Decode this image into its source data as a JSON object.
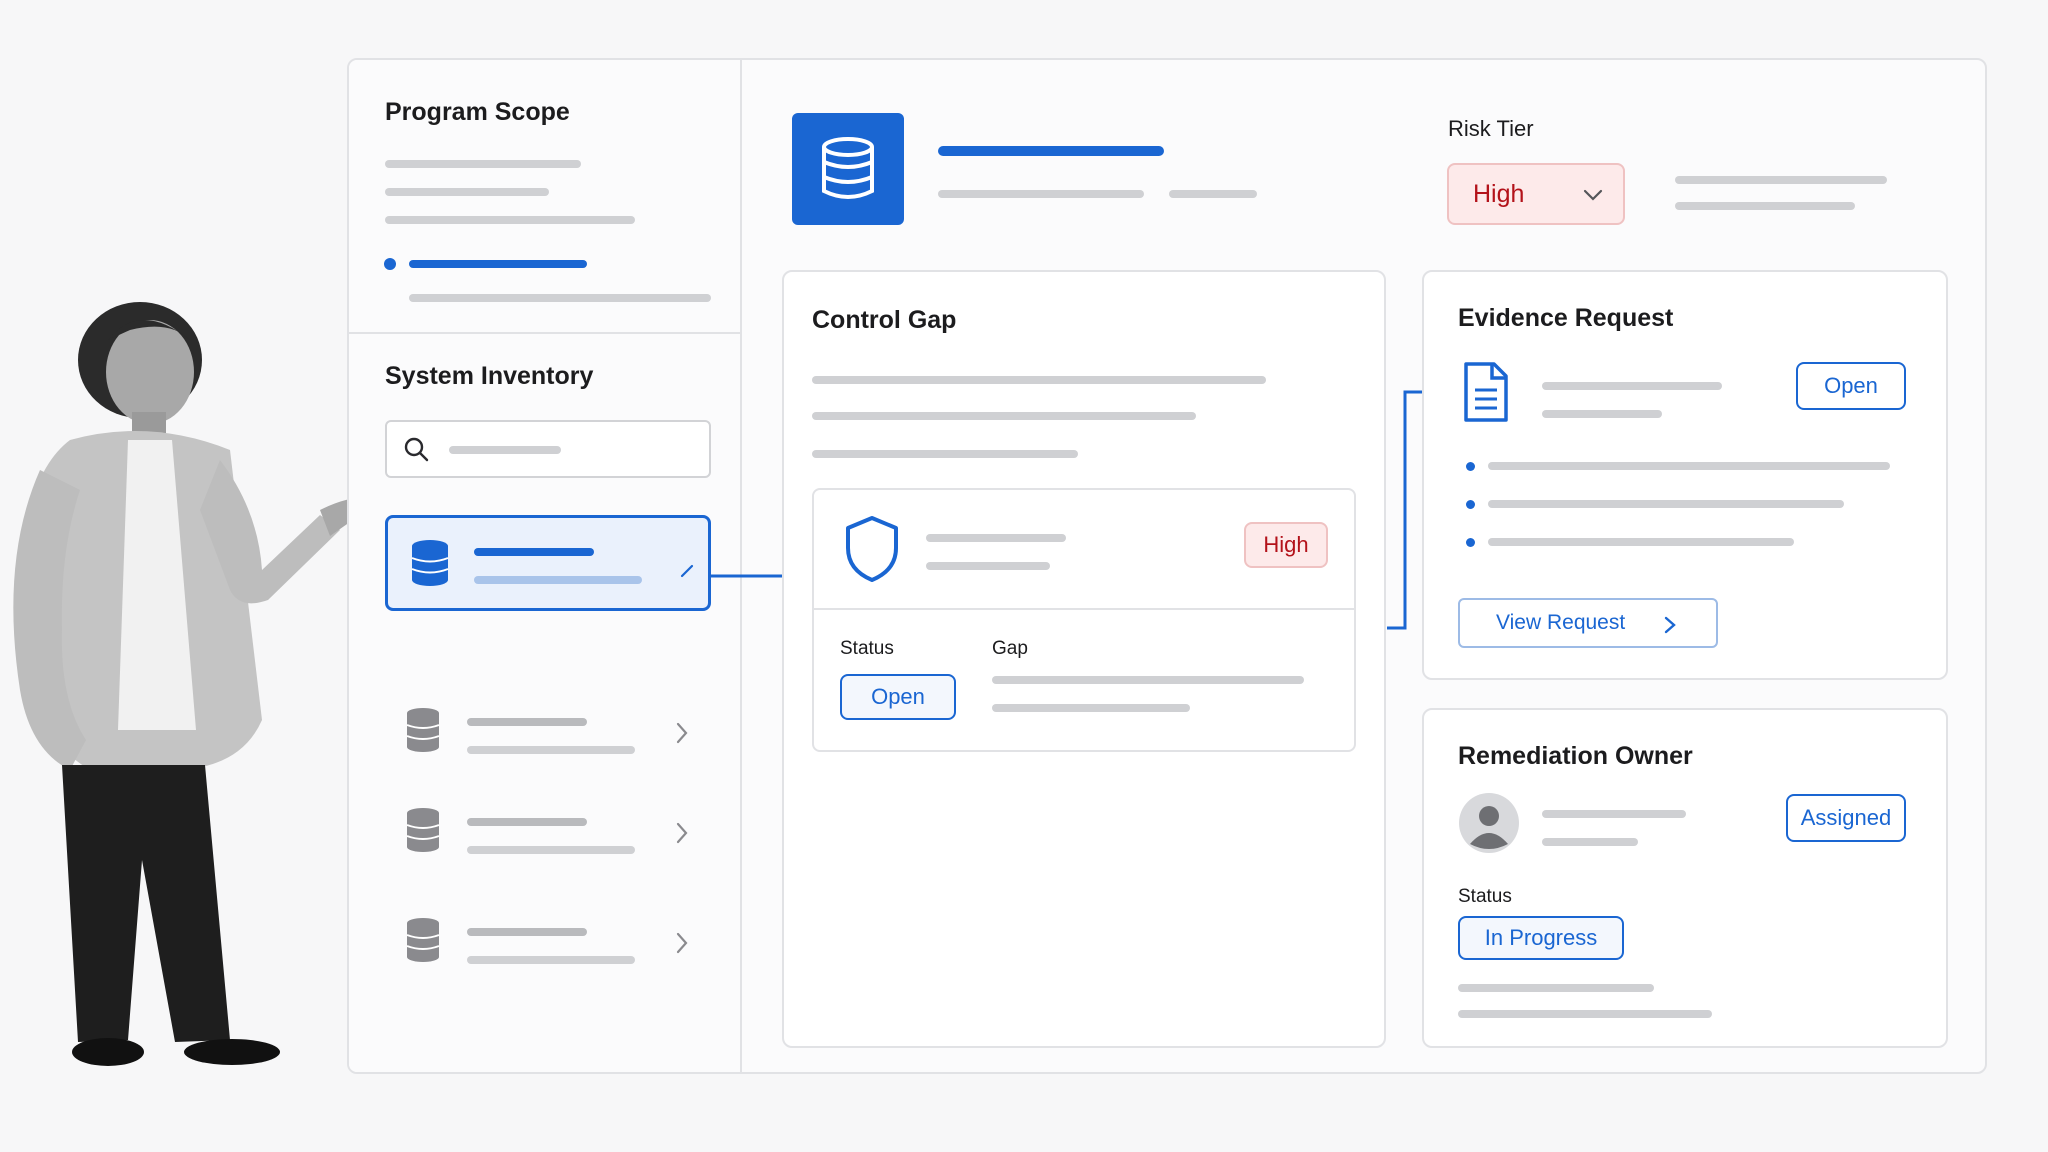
{
  "sidebar": {
    "program_scope_title": "Program Scope",
    "system_inventory_title": "System Inventory",
    "search": {
      "icon": "search-icon"
    },
    "inventory_items": [
      {
        "icon": "database-icon",
        "selected": true,
        "action_icon": "edit-icon"
      },
      {
        "icon": "database-icon",
        "selected": false,
        "action_icon": "chevron-right-icon"
      },
      {
        "icon": "database-icon",
        "selected": false,
        "action_icon": "chevron-right-icon"
      },
      {
        "icon": "database-icon",
        "selected": false,
        "action_icon": "chevron-right-icon"
      }
    ]
  },
  "header": {
    "icon": "database-icon",
    "risk_tier_label": "Risk Tier",
    "risk_tier_value": "High"
  },
  "control_gap": {
    "title": "Control Gap",
    "finding": {
      "icon": "shield-icon",
      "severity": "High",
      "status_label": "Status",
      "status_value": "Open",
      "gap_label": "Gap"
    }
  },
  "evidence_request": {
    "title": "Evidence Request",
    "icon": "document-icon",
    "status": "Open",
    "button_label": "View Request"
  },
  "remediation_owner": {
    "title": "Remediation Owner",
    "avatar_icon": "avatar-icon",
    "assignment": "Assigned",
    "status_label": "Status",
    "status_value": "In Progress"
  },
  "colors": {
    "accent": "#1a66d2",
    "danger": "#b3121a",
    "danger_bg": "#fdeaea"
  }
}
